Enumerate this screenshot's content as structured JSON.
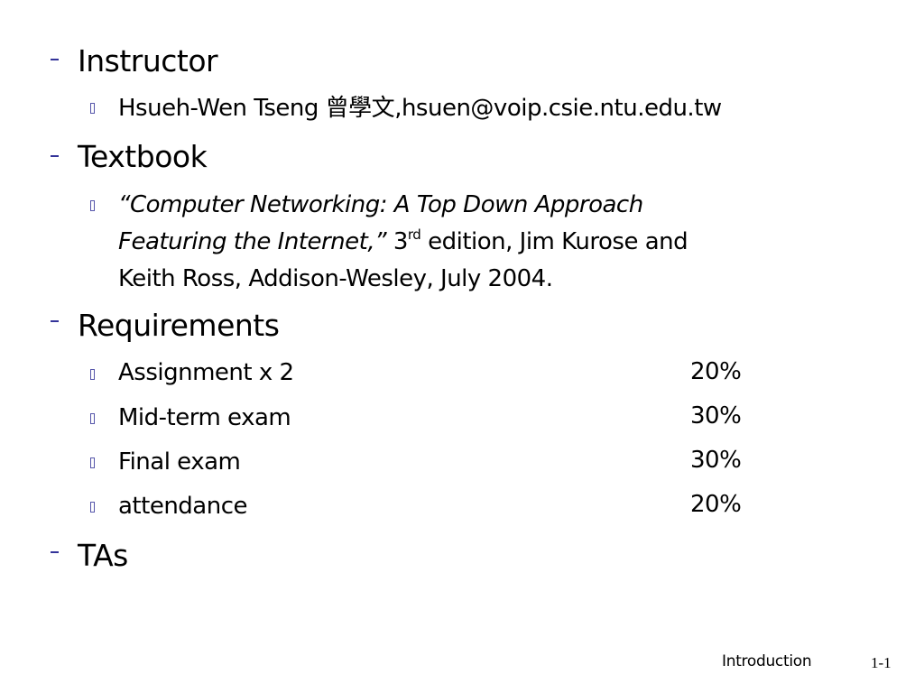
{
  "slide": {
    "sections": [
      {
        "heading": "Instructor"
      },
      {
        "heading": "Textbook"
      },
      {
        "heading": "Requirements"
      },
      {
        "heading": "TAs"
      }
    ],
    "instructor": {
      "name": "Hsueh-Wen Tseng",
      "chinese_name": "曾學文",
      "email": ",hsuen@voip.csie.ntu.edu.tw"
    },
    "textbook": {
      "title_line1": "“Computer Networking: A Top Down Approach",
      "title_line2": "Featuring the Internet,”",
      "edition_num": " 3",
      "edition_sup": "rd",
      "edition_rest": " edition, Jim Kurose and",
      "line3": "Keith Ross, Addison-Wesley, July 2004."
    },
    "requirements": [
      {
        "item": "Assignment x 2",
        "weight": "20%"
      },
      {
        "item": "Mid-term exam",
        "weight": "30%"
      },
      {
        "item": "Final exam",
        "weight": "30%"
      },
      {
        "item": "attendance",
        "weight": "20%"
      }
    ]
  },
  "footer": {
    "title": "Introduction",
    "page": "1-1"
  }
}
